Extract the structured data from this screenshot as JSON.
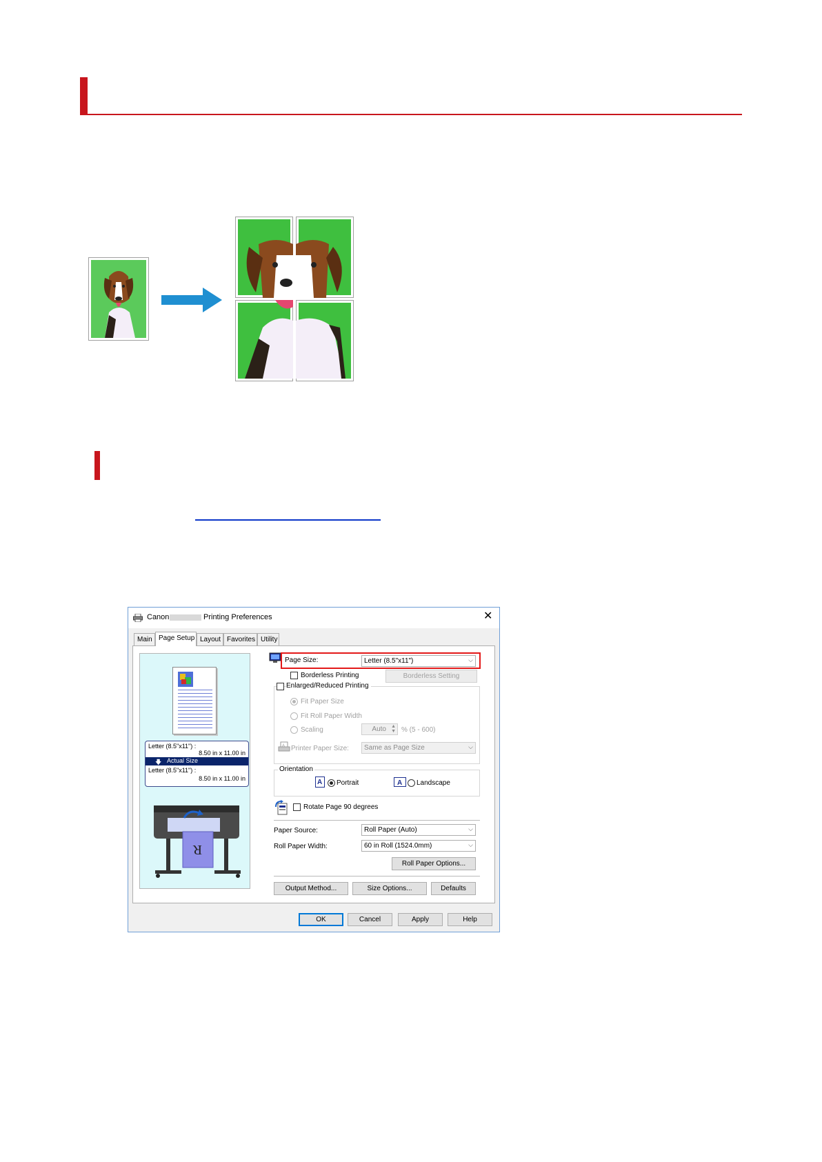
{
  "dialog": {
    "title_prefix": "Canon",
    "title_suffix": "Printing Preferences",
    "close_glyph": "✕",
    "tabs": [
      "Main",
      "Page Setup",
      "Layout",
      "Favorites",
      "Utility"
    ],
    "active_tab": "Page Setup",
    "preview": {
      "source_size": "Letter (8.5\"x11\") :",
      "source_dims": "8.50 in x 11.00 in",
      "scale_label": "Actual Size",
      "output_size": "Letter (8.5\"x11\") :",
      "output_dims": "8.50 in x 11.00 in"
    },
    "page_size_label": "Page Size:",
    "page_size_value": "Letter (8.5\"x11\")",
    "borderless_label": "Borderless Printing",
    "borderless_setting_button": "Borderless Setting",
    "enlarged_label": "Enlarged/Reduced Printing",
    "fit_paper_size": "Fit Paper Size",
    "fit_roll_width": "Fit Roll Paper Width",
    "scaling_label": "Scaling",
    "scaling_value": "Auto",
    "scaling_range": "% (5 - 600)",
    "printer_paper_size_label": "Printer Paper Size:",
    "printer_paper_size_value": "Same as Page Size",
    "orientation_label": "Orientation",
    "portrait_label": "Portrait",
    "landscape_label": "Landscape",
    "rotate_label": "Rotate Page 90 degrees",
    "paper_source_label": "Paper Source:",
    "paper_source_value": "Roll Paper (Auto)",
    "roll_width_label": "Roll Paper Width:",
    "roll_width_value": "60 in Roll (1524.0mm)",
    "roll_options_button": "Roll Paper Options...",
    "output_method_button": "Output Method...",
    "size_options_button": "Size Options...",
    "defaults_button": "Defaults",
    "ok_button": "OK",
    "cancel_button": "Cancel",
    "apply_button": "Apply",
    "help_button": "Help"
  },
  "colors": {
    "heading_accent": "#c8161d",
    "link": "#0b35c8",
    "highlight_box": "#e31818",
    "arrow": "#1f8fd1",
    "photo_background": "#3fbf3f"
  }
}
